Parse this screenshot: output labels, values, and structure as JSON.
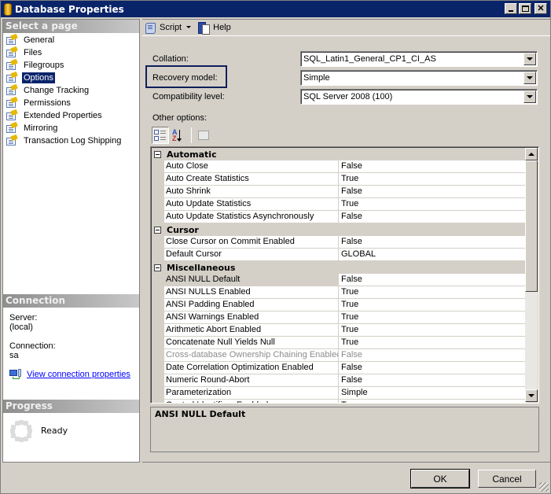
{
  "window": {
    "title": "Database Properties",
    "controls": [
      "minimize",
      "maximize",
      "close"
    ]
  },
  "left_pane": {
    "select_page_header": "Select a page",
    "pages": [
      {
        "label": "General",
        "icon": "page-icon",
        "selected": false
      },
      {
        "label": "Files",
        "icon": "page-icon",
        "selected": false
      },
      {
        "label": "Filegroups",
        "icon": "page-icon",
        "selected": false
      },
      {
        "label": "Options",
        "icon": "page-icon",
        "selected": true
      },
      {
        "label": "Change Tracking",
        "icon": "page-icon",
        "selected": false
      },
      {
        "label": "Permissions",
        "icon": "page-icon",
        "selected": false
      },
      {
        "label": "Extended Properties",
        "icon": "page-icon",
        "selected": false
      },
      {
        "label": "Mirroring",
        "icon": "page-icon",
        "selected": false
      },
      {
        "label": "Transaction Log Shipping",
        "icon": "page-icon",
        "selected": false
      }
    ],
    "connection": {
      "header": "Connection",
      "server_label": "Server:",
      "server_value": "(local)",
      "connection_label": "Connection:",
      "connection_value": "sa",
      "link": "View connection properties"
    },
    "progress": {
      "header": "Progress",
      "status": "Ready"
    }
  },
  "toolbar": {
    "script_label": "Script",
    "help_label": "Help"
  },
  "form": {
    "collation_label": "Collation:",
    "collation_value": "SQL_Latin1_General_CP1_CI_AS",
    "recovery_label": "Recovery model:",
    "recovery_value": "Simple",
    "compat_label": "Compatibility level:",
    "compat_value": "SQL Server 2008 (100)",
    "other_options_label": "Other options:"
  },
  "property_grid": {
    "categories": [
      {
        "name": "Automatic",
        "rows": [
          {
            "name": "Auto Close",
            "value": "False"
          },
          {
            "name": "Auto Create Statistics",
            "value": "True"
          },
          {
            "name": "Auto Shrink",
            "value": "False"
          },
          {
            "name": "Auto Update Statistics",
            "value": "True"
          },
          {
            "name": "Auto Update Statistics Asynchronously",
            "value": "False"
          }
        ]
      },
      {
        "name": "Cursor",
        "rows": [
          {
            "name": "Close Cursor on Commit Enabled",
            "value": "False"
          },
          {
            "name": "Default Cursor",
            "value": "GLOBAL"
          }
        ]
      },
      {
        "name": "Miscellaneous",
        "rows": [
          {
            "name": "ANSI NULL Default",
            "value": "False",
            "selected": true
          },
          {
            "name": "ANSI NULLS Enabled",
            "value": "True"
          },
          {
            "name": "ANSI Padding Enabled",
            "value": "True"
          },
          {
            "name": "ANSI Warnings Enabled",
            "value": "True"
          },
          {
            "name": "Arithmetic Abort Enabled",
            "value": "True"
          },
          {
            "name": "Concatenate Null Yields Null",
            "value": "True"
          },
          {
            "name": "Cross-database Ownership Chaining Enabled",
            "value": "False",
            "disabled": true
          },
          {
            "name": "Date Correlation Optimization Enabled",
            "value": "False"
          },
          {
            "name": "Numeric Round-Abort",
            "value": "False"
          },
          {
            "name": "Parameterization",
            "value": "Simple"
          },
          {
            "name": "Quoted Identifiers Enabled",
            "value": "True"
          }
        ]
      }
    ],
    "description_title": "ANSI NULL Default"
  },
  "buttons": {
    "ok": "OK",
    "cancel": "Cancel"
  }
}
